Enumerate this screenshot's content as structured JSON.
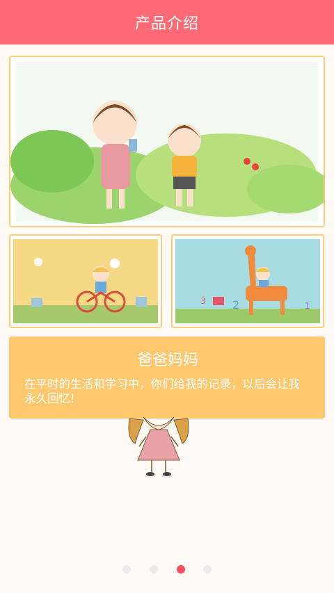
{
  "header": {
    "title": "产品介绍"
  },
  "slide": {
    "title": "爸爸妈妈",
    "description": "在平时的生活和学习中，你们给我的记录，以后会让我永久回忆!"
  },
  "pager": {
    "count": 4,
    "active_index": 2
  },
  "colors": {
    "header": "#ff6b75",
    "card_border": "#ffcc7a",
    "info_bg": "#ffc86e",
    "dot_active": "#ff4d5e",
    "dot_inactive": "#ececec"
  }
}
